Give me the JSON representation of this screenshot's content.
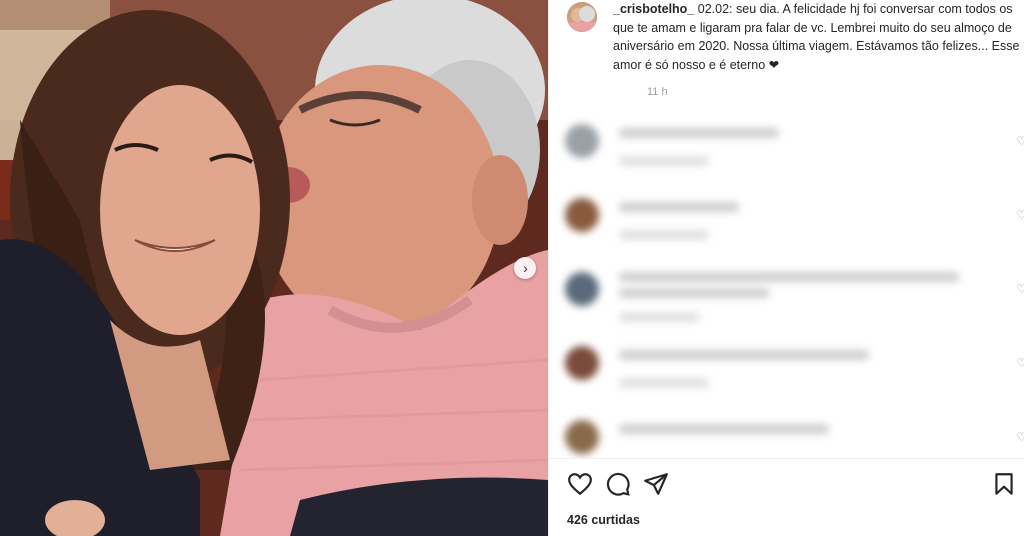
{
  "post": {
    "username": "_crisbotelho_",
    "caption": "02.02: seu dia. A felicidade hj foi conversar com todos os que te amam e ligaram pra falar de vc. Lembrei muito do seu almoço de aniversário em 2020. Nossa última viagem. Estávamos tão felizes... Esse amor é só nosso e é eterno ❤",
    "timestamp": "11 h",
    "likes_label": "426 curtidas"
  },
  "comments": [
    {
      "avatar_color": "#9aa0a6"
    },
    {
      "avatar_color": "#8a5a3c"
    },
    {
      "avatar_color": "#5a6a7a"
    },
    {
      "avatar_color": "#7a4a3a"
    },
    {
      "avatar_color": "#8a6a4a"
    }
  ],
  "icons": {
    "like": "heart-icon",
    "comment": "comment-icon",
    "share": "send-icon",
    "save": "bookmark-icon",
    "carousel": "chevron-right-icon"
  },
  "colors": {
    "text": "#262626",
    "muted": "#a0a0a0",
    "sweater": "#e8a2a4"
  }
}
